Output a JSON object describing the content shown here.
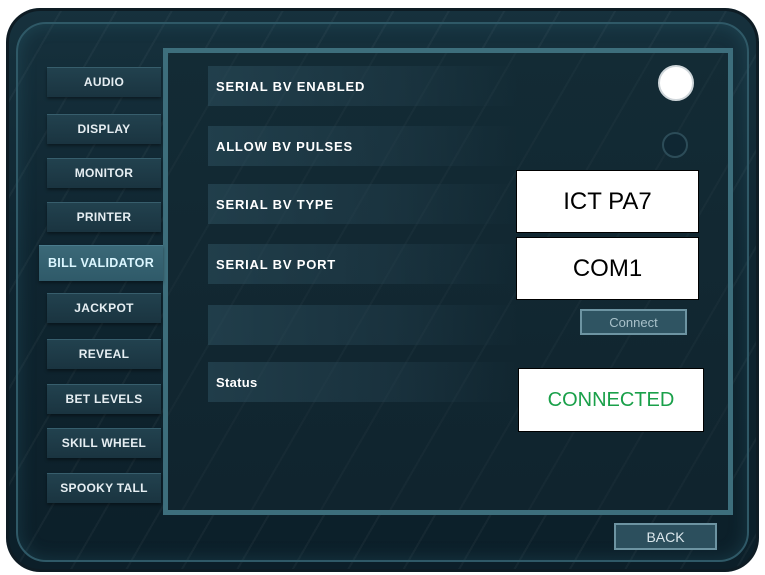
{
  "sidebar": {
    "items": [
      {
        "label": "AUDIO"
      },
      {
        "label": "DISPLAY"
      },
      {
        "label": "MONITOR"
      },
      {
        "label": "PRINTER"
      },
      {
        "label": "BILL VALIDATOR",
        "active": true
      },
      {
        "label": "JACKPOT"
      },
      {
        "label": "REVEAL"
      },
      {
        "label": "BET LEVELS"
      },
      {
        "label": "SKILL WHEEL"
      },
      {
        "label": "SPOOKY TALL"
      }
    ]
  },
  "settings": {
    "serial_bv_enabled": {
      "label": "SERIAL BV ENABLED",
      "value": true
    },
    "allow_bv_pulses": {
      "label": "ALLOW BV PULSES",
      "value": false
    },
    "serial_bv_type": {
      "label": "SERIAL BV TYPE",
      "value": "ICT PA7"
    },
    "serial_bv_port": {
      "label": "SERIAL BV PORT",
      "value": "COM1"
    },
    "connect_label": "Connect",
    "status": {
      "label": "Status",
      "value": "CONNECTED",
      "color": "#1aa04a"
    }
  },
  "footer": {
    "back_label": "BACK"
  },
  "colors": {
    "accent": "#3d6e7c",
    "status_connected": "#1aa04a"
  }
}
